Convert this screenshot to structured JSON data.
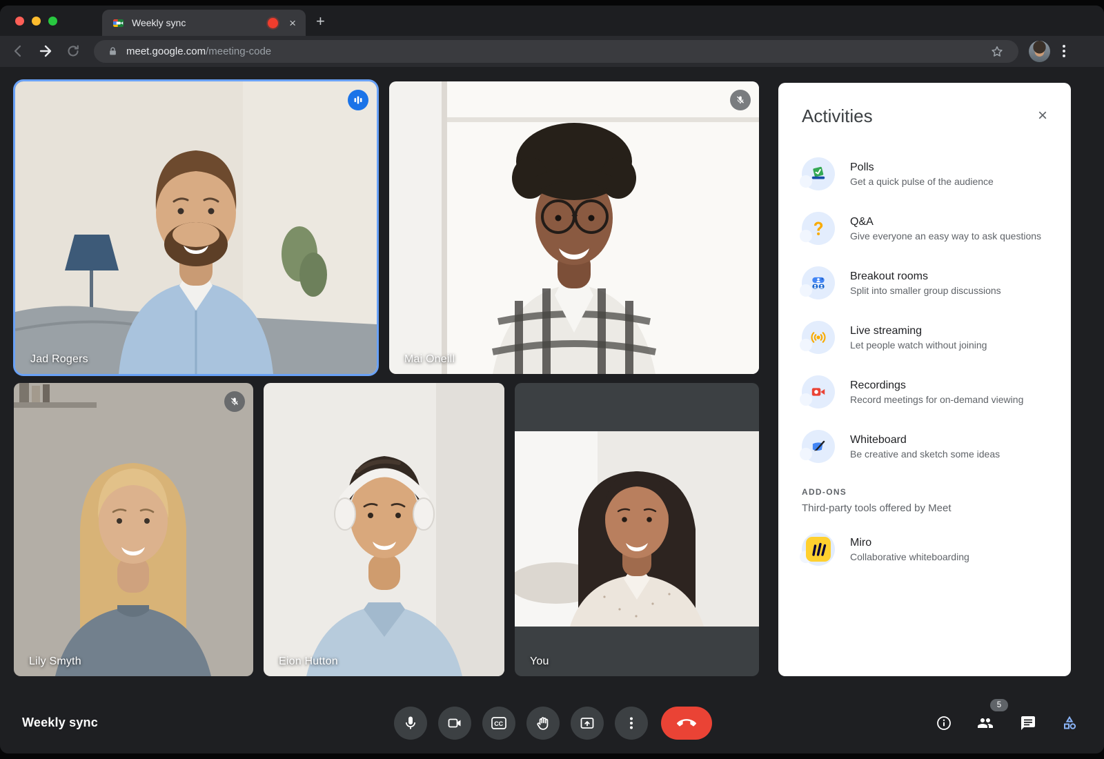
{
  "browser": {
    "tab": {
      "title": "Weekly sync",
      "favicon": "google-meet-logo",
      "recording_indicator": true,
      "close_label": "×"
    },
    "new_tab_label": "+",
    "url": {
      "domain": "meet.google.com",
      "path": "/meeting-code"
    }
  },
  "meeting": {
    "title": "Weekly sync",
    "participants": [
      {
        "name": "Jad Rogers",
        "state": "speaking"
      },
      {
        "name": "Mai Oneill",
        "state": "muted"
      },
      {
        "name": "Lily Smyth",
        "state": "muted"
      },
      {
        "name": "Eion Hutton",
        "state": ""
      },
      {
        "name": "You",
        "state": ""
      }
    ],
    "controls": {
      "cc_label": "CC",
      "participants_badge": "5"
    }
  },
  "panel": {
    "title": "Activities",
    "close_label": "×",
    "items": [
      {
        "name": "Polls",
        "description": "Get a quick pulse of the audience",
        "icon": "polls-icon"
      },
      {
        "name": "Q&A",
        "description": "Give everyone an easy way to ask questions",
        "icon": "qa-icon"
      },
      {
        "name": "Breakout rooms",
        "description": "Split into smaller group discussions",
        "icon": "breakout-rooms-icon"
      },
      {
        "name": "Live streaming",
        "description": "Let people watch without joining",
        "icon": "live-streaming-icon"
      },
      {
        "name": "Recordings",
        "description": "Record meetings for on-demand viewing",
        "icon": "recordings-icon"
      },
      {
        "name": "Whiteboard",
        "description": "Be creative and sketch some ideas",
        "icon": "whiteboard-icon"
      }
    ],
    "addons": {
      "label": "ADD-ONS",
      "subtitle": "Third-party tools offered by Meet",
      "items": [
        {
          "name": "Miro",
          "description": "Collaborative whiteboarding",
          "icon": "miro-icon"
        }
      ]
    }
  },
  "colors": {
    "accent_blue": "#1a73e8",
    "speaking_border": "#69a1f6",
    "end_call_red": "#ea4335",
    "activities_active": "#8ab4f8",
    "panel_icon_bg": "#e3edfd"
  }
}
